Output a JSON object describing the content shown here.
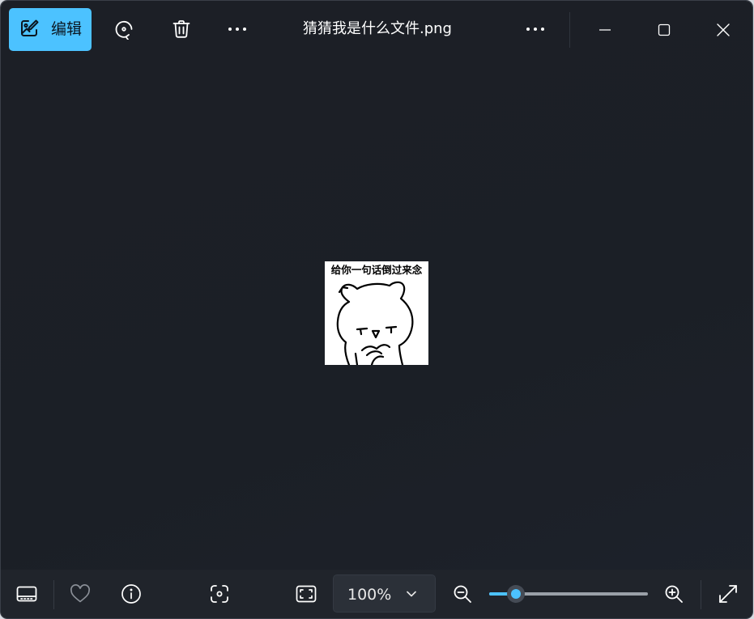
{
  "window": {
    "title": "猜猜我是什么文件.png"
  },
  "toolbar": {
    "edit_label": "编辑",
    "edit_icon": "edit-image-icon",
    "rotate_icon": "rotate-icon",
    "delete_icon": "trash-icon",
    "more_icon": "more-horizontal-icon"
  },
  "window_controls": {
    "more_icon": "more-horizontal-icon",
    "minimize_icon": "minimize-icon",
    "maximize_icon": "maximize-icon",
    "close_icon": "close-icon"
  },
  "image": {
    "caption": "给你一句话倒过来念"
  },
  "bottombar": {
    "filmstrip_icon": "filmstrip-icon",
    "favorite_icon": "heart-icon",
    "info_icon": "info-icon",
    "visual_search_icon": "visual-search-icon",
    "fit_icon": "fit-to-window-icon",
    "zoom_value": "100%",
    "zoom_out_icon": "zoom-out-icon",
    "zoom_in_icon": "zoom-in-icon",
    "fullscreen_icon": "fullscreen-icon",
    "zoom_slider_fraction": 0.17
  },
  "colors": {
    "accent": "#4cc2ff",
    "background": "#1c1f26",
    "bar": "#20242b"
  }
}
